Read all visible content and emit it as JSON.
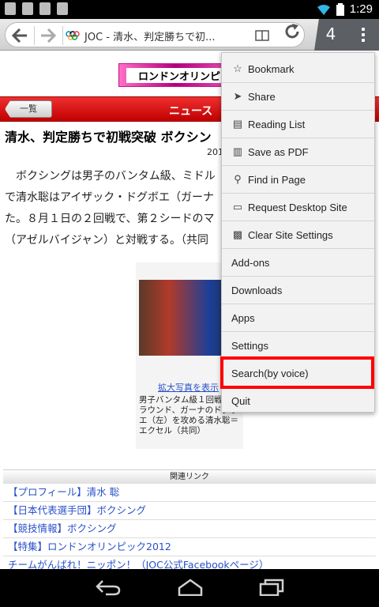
{
  "status_bar": {
    "time": "1:29"
  },
  "browser": {
    "tab_title": "JOC - 清水、判定勝ちで初...",
    "tab_count": "4"
  },
  "page": {
    "banner_text": "ロンドンオリンピック",
    "list_button": "一覧",
    "section_label": "ニュース",
    "headline": "清水、判定勝ちで初戦突破 ボクシン",
    "date": "201",
    "date_suffix": "2",
    "article_lines": [
      "　ボクシングは男子のバンタム級、ミドル",
      "で清水聡はアイザック・ドグボエ（ガーナ",
      "た。８月１日の２回戦で、第２シードのマ",
      "（アゼルバイジャン）と対戦する。（共同"
    ],
    "photo_link": "拡大写真を表示",
    "photo_caption": "男子バンタム級１回戦第１ラウンド、ガーナのドグボエ（左）を攻める清水聡＝エクセル（共同）",
    "related_heading": "関連リンク",
    "related_links": [
      "【プロフィール】清水 聡",
      "【日本代表選手団】ボクシング",
      "【競技情報】ボクシング",
      "【特集】ロンドンオリンピック2012",
      "チームがんばれ！ニッポン！（JOC公式Facebookページ）"
    ]
  },
  "menu": {
    "items": [
      {
        "label": "Bookmark",
        "icon": "star-icon"
      },
      {
        "label": "Share",
        "icon": "share-icon"
      },
      {
        "label": "Reading List",
        "icon": "book-icon"
      },
      {
        "label": "Save as PDF",
        "icon": "pdf-icon"
      },
      {
        "label": "Find in Page",
        "icon": "search-icon"
      },
      {
        "label": "Request Desktop Site",
        "icon": "monitor-icon"
      },
      {
        "label": "Clear Site Settings",
        "icon": "trash-icon"
      },
      {
        "label": "Add-ons",
        "icon": ""
      },
      {
        "label": "Downloads",
        "icon": ""
      },
      {
        "label": "Apps",
        "icon": ""
      },
      {
        "label": "Settings",
        "icon": ""
      },
      {
        "label": "Search(by voice)",
        "icon": ""
      },
      {
        "label": "Quit",
        "icon": ""
      }
    ],
    "highlighted_item": "Search(by voice)",
    "highlight_color": "#ff0000"
  }
}
